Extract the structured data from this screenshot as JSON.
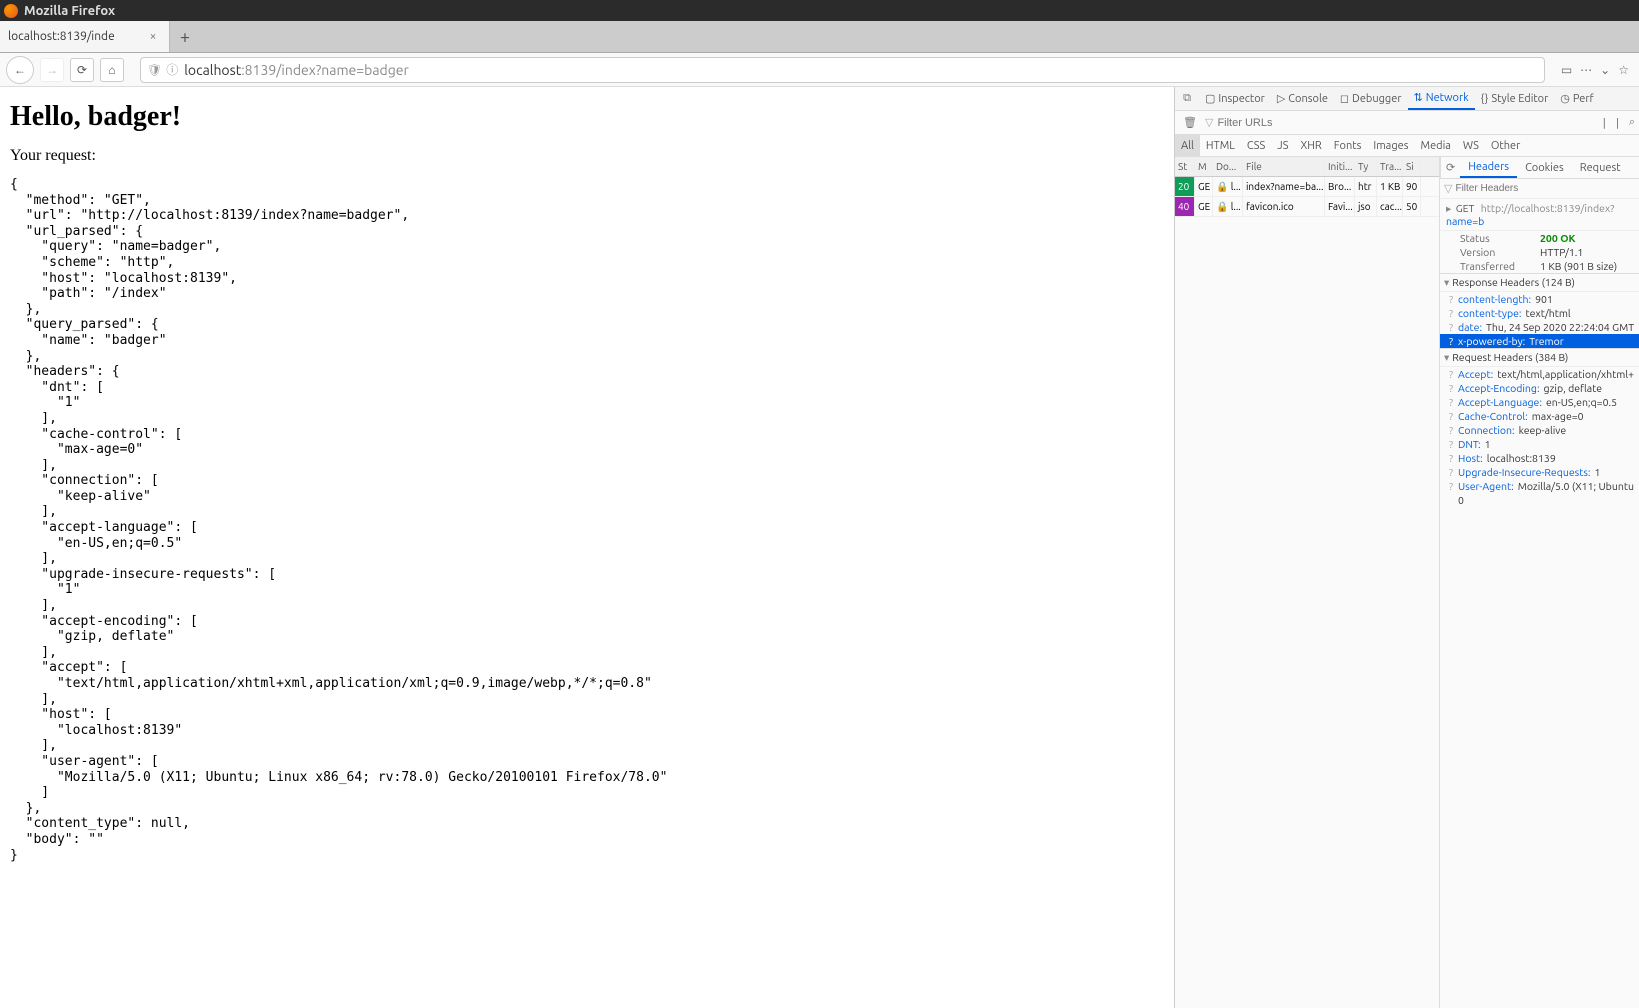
{
  "window": {
    "title": "Mozilla Firefox"
  },
  "tab": {
    "title": "localhost:8139/inde"
  },
  "url": {
    "host": "localhost",
    "port": ":8139",
    "path": "/index?name=badger"
  },
  "page": {
    "heading": "Hello, badger!",
    "subheading": "Your request:",
    "body": "{\n  \"method\": \"GET\",\n  \"url\": \"http://localhost:8139/index?name=badger\",\n  \"url_parsed\": {\n    \"query\": \"name=badger\",\n    \"scheme\": \"http\",\n    \"host\": \"localhost:8139\",\n    \"path\": \"/index\"\n  },\n  \"query_parsed\": {\n    \"name\": \"badger\"\n  },\n  \"headers\": {\n    \"dnt\": [\n      \"1\"\n    ],\n    \"cache-control\": [\n      \"max-age=0\"\n    ],\n    \"connection\": [\n      \"keep-alive\"\n    ],\n    \"accept-language\": [\n      \"en-US,en;q=0.5\"\n    ],\n    \"upgrade-insecure-requests\": [\n      \"1\"\n    ],\n    \"accept-encoding\": [\n      \"gzip, deflate\"\n    ],\n    \"accept\": [\n      \"text/html,application/xhtml+xml,application/xml;q=0.9,image/webp,*/*;q=0.8\"\n    ],\n    \"host\": [\n      \"localhost:8139\"\n    ],\n    \"user-agent\": [\n      \"Mozilla/5.0 (X11; Ubuntu; Linux x86_64; rv:78.0) Gecko/20100101 Firefox/78.0\"\n    ]\n  },\n  \"content_type\": null,\n  \"body\": \"\"\n}"
  },
  "devtools": {
    "tabs": {
      "inspector": "Inspector",
      "console": "Console",
      "debugger": "Debugger",
      "network": "Network",
      "style": "Style Editor",
      "perf": "Perf"
    },
    "filter_placeholder": "Filter URLs",
    "type_filters": [
      "All",
      "HTML",
      "CSS",
      "JS",
      "XHR",
      "Fonts",
      "Images",
      "Media",
      "WS",
      "Other"
    ],
    "columns": {
      "st": "St",
      "me": "M",
      "do": "Do...",
      "fi": "File",
      "in": "Initi...",
      "ty": "Ty",
      "tr": "Tra...",
      "si": "Si"
    },
    "requests": [
      {
        "status": "20",
        "method": "GE",
        "domain": "🔒 l...",
        "file": "index?name=ba...",
        "init": "Bro...",
        "type": "htr",
        "trans": "1 KB",
        "size": "90"
      },
      {
        "status": "40",
        "method": "GE",
        "domain": "🔒 l...",
        "file": "favicon.ico",
        "init": "Favi...",
        "type": "jso",
        "trans": "cac...",
        "size": "50"
      }
    ],
    "detail_tabs": {
      "headers": "Headers",
      "cookies": "Cookies",
      "request": "Request"
    },
    "filter_headers_placeholder": "Filter Headers",
    "summary": {
      "verb": "GET",
      "url_prefix": "http://localhost:8139/index?",
      "url_qs": "name=b"
    },
    "status_block": {
      "status_k": "Status",
      "status_v": "200 OK",
      "version_k": "Version",
      "version_v": "HTTP/1.1",
      "transferred_k": "Transferred",
      "transferred_v": "1 KB (901 B size)"
    },
    "resp_title": "Response Headers (124 B)",
    "resp_headers": [
      {
        "k": "content-length:",
        "v": "901"
      },
      {
        "k": "content-type:",
        "v": "text/html"
      },
      {
        "k": "date:",
        "v": "Thu, 24 Sep 2020 22:24:04 GMT"
      },
      {
        "k": "x-powered-by:",
        "v": "Tremor"
      }
    ],
    "req_title": "Request Headers (384 B)",
    "req_headers": [
      {
        "k": "Accept:",
        "v": "text/html,application/xhtml+"
      },
      {
        "k": "Accept-Encoding:",
        "v": "gzip, deflate"
      },
      {
        "k": "Accept-Language:",
        "v": "en-US,en;q=0.5"
      },
      {
        "k": "Cache-Control:",
        "v": "max-age=0"
      },
      {
        "k": "Connection:",
        "v": "keep-alive"
      },
      {
        "k": "DNT:",
        "v": "1"
      },
      {
        "k": "Host:",
        "v": "localhost:8139"
      },
      {
        "k": "Upgrade-Insecure-Requests:",
        "v": "1"
      },
      {
        "k": "User-Agent:",
        "v": "Mozilla/5.0 (X11; Ubuntu"
      }
    ],
    "req_trailing": "0"
  }
}
